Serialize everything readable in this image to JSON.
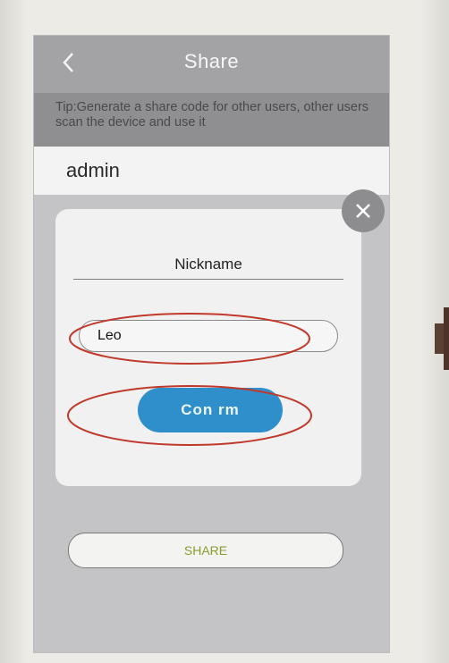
{
  "header": {
    "title": "Share"
  },
  "tip": {
    "text": "Tip:Generate a share code for other users, other users scan the device and use it"
  },
  "admin_row": {
    "username": "admin"
  },
  "dialog": {
    "nickname_label": "Nickname",
    "nickname_value": "Leo",
    "confirm_label": "Con  rm"
  },
  "share_button": {
    "label": "SHARE"
  },
  "icons": {
    "back": "chevron-left-icon",
    "close": "close-icon",
    "arrow": "arrow-right-icon"
  },
  "colors": {
    "header_bg": "#a3a3a6",
    "confirm_bg": "#2e8fcb",
    "annotation_red": "#c0392b",
    "share_text": "#8c9a2e"
  }
}
